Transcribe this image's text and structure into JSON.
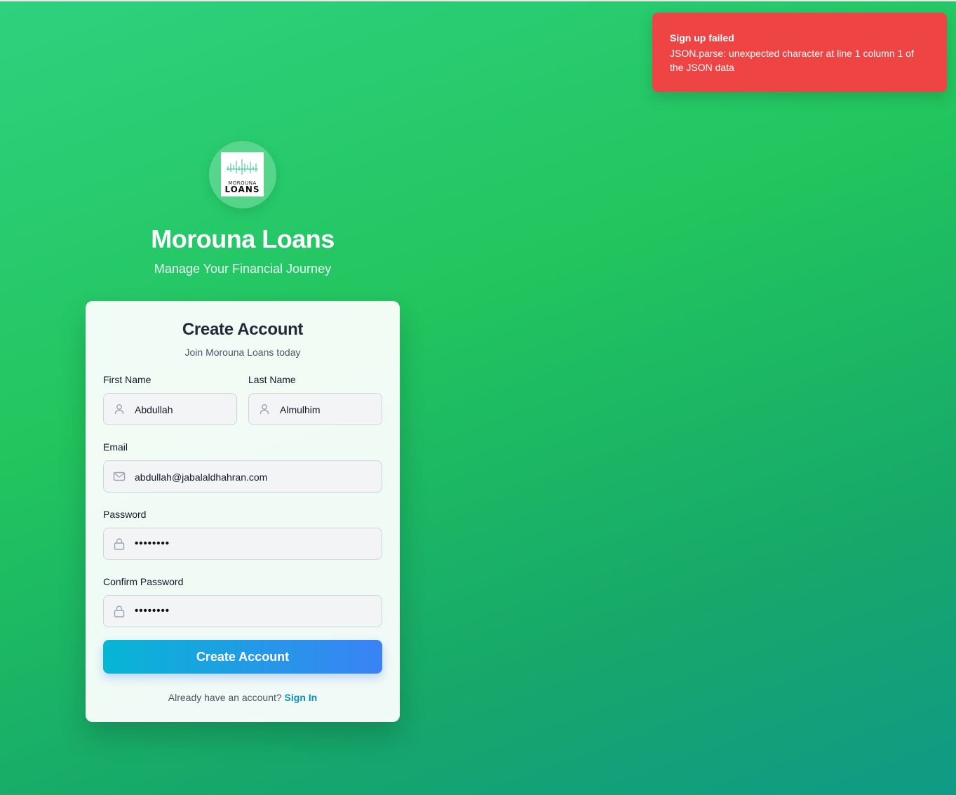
{
  "toast": {
    "title": "Sign up failed",
    "message": "JSON.parse: unexpected character at line 1 column 1 of the JSON data",
    "color": "#ef4444"
  },
  "brand": {
    "logo_line1": "MOROUNA",
    "logo_line2": "LOANS",
    "title": "Morouna Loans",
    "subtitle": "Manage Your Financial Journey"
  },
  "form": {
    "title": "Create Account",
    "subtitle": "Join Morouna Loans today",
    "first_name": {
      "label": "First Name",
      "value": "Abdullah",
      "icon": "user-icon"
    },
    "last_name": {
      "label": "Last Name",
      "value": "Almulhim",
      "icon": "user-icon"
    },
    "email": {
      "label": "Email",
      "value": "abdullah@jabalaldhahran.com",
      "icon": "mail-icon"
    },
    "password": {
      "label": "Password",
      "value": "••••••••",
      "icon": "lock-icon"
    },
    "confirm_password": {
      "label": "Confirm Password",
      "value": "••••••••",
      "icon": "lock-icon"
    },
    "submit_label": "Create Account",
    "footer_text": "Already have an account?",
    "signin_label": "Sign In"
  },
  "colors": {
    "accent_start": "#06b6d4",
    "accent_end": "#3b82f6",
    "link": "#0891b2",
    "error": "#ef4444"
  }
}
